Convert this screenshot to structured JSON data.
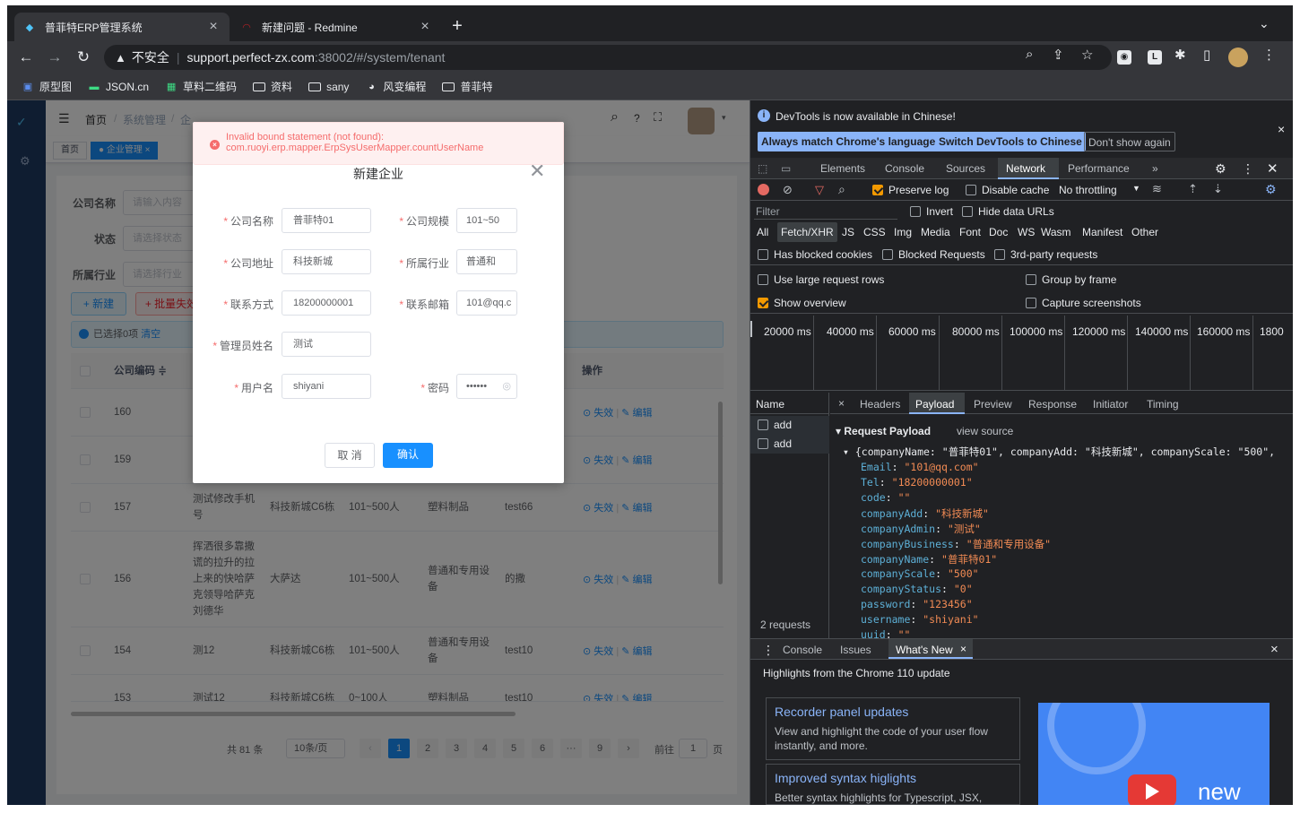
{
  "browser": {
    "tabs": [
      {
        "title": "普菲特ERP管理系统",
        "active": true
      },
      {
        "title": "新建问题 - Redmine",
        "active": false
      }
    ],
    "url": {
      "warning": "不安全",
      "host": "support.perfect-zx.com",
      "path": ":38002/#/system/tenant"
    },
    "bookmarks": [
      "原型图",
      "JSON.cn",
      "草料二维码",
      "资料",
      "sany",
      "风变编程",
      "普菲特"
    ]
  },
  "app": {
    "breadcrumb": [
      "首页",
      "/",
      "系统管理",
      "/",
      "企"
    ],
    "tags": [
      "首页",
      "● 企业管理 ×"
    ],
    "search": {
      "company_label": "公司名称",
      "company_placeholder": "请输入内容",
      "status_label": "状态",
      "status_placeholder": "请选择状态",
      "industry_label": "所属行业",
      "industry_placeholder": "请选择行业"
    },
    "buttons": {
      "add": "+ 新建",
      "batch": "+ 批量失效"
    },
    "selection": {
      "text": "已选择0项",
      "clear": "清空"
    },
    "table": {
      "col_code": "公司编码 ≑",
      "col_ops": "操作",
      "action_disable": "⊙ 失效",
      "action_sep": "|",
      "action_edit": "✎ 编辑",
      "rows": [
        {
          "code": "160",
          "name": "",
          "addr": "",
          "scale": "",
          "industry": "",
          "admin": ""
        },
        {
          "code": "159",
          "name": "",
          "addr": "",
          "scale": "",
          "industry": "",
          "admin": ""
        },
        {
          "code": "157",
          "name": "测试修改手机号",
          "addr": "科技新城C6栋",
          "scale": "101~500人",
          "industry": "塑料制品",
          "admin": "test66"
        },
        {
          "code": "156",
          "name": "挥洒很多靠撒谎的拉升的拉上来的快哈萨克领导哈萨克刘德华",
          "addr": "大萨达",
          "scale": "101~500人",
          "industry": "普通和专用设备",
          "admin": "的撒"
        },
        {
          "code": "154",
          "name": "测12",
          "addr": "科技新城C6栋",
          "scale": "101~500人",
          "industry": "普通和专用设备",
          "admin": "test10"
        },
        {
          "code": "153",
          "name": "测试12",
          "addr": "科技新城C6栋",
          "scale": "0~100人",
          "industry": "塑料制品",
          "admin": "test10"
        }
      ]
    },
    "pagination": {
      "total": "共 81 条",
      "size": "10条/页",
      "pages": [
        "1",
        "2",
        "3",
        "4",
        "5",
        "6",
        "···",
        "9"
      ],
      "current": "1",
      "goto_label": "前往",
      "goto_value": "1",
      "goto_suffix": "页"
    }
  },
  "dialog": {
    "error": {
      "line1": "Invalid bound statement (not found):",
      "line2": "com.ruoyi.erp.mapper.ErpSysUserMapper.countUserName"
    },
    "title": "新建企业",
    "fields": {
      "company_name": {
        "label": "公司名称",
        "value": "普菲特01"
      },
      "company_scale": {
        "label": "公司规模",
        "value": "101~50"
      },
      "company_addr": {
        "label": "公司地址",
        "value": "科技新城"
      },
      "industry": {
        "label": "所属行业",
        "value": "普通和"
      },
      "phone": {
        "label": "联系方式",
        "value": "18200000001"
      },
      "email": {
        "label": "联系邮箱",
        "value": "101@qq.c"
      },
      "admin_name": {
        "label": "管理员姓名",
        "value": "测试"
      },
      "username": {
        "label": "用户名",
        "value": "shiyani"
      },
      "password": {
        "label": "密码",
        "value": "••••••"
      }
    },
    "cancel": "取 消",
    "confirm": "确认"
  },
  "devtools": {
    "banner": "DevTools is now available in Chinese!",
    "banner_buttons": [
      "Always match Chrome's language",
      "Switch DevTools to Chinese",
      "Don't show again"
    ],
    "main_tabs": [
      "Elements",
      "Console",
      "Sources",
      "Network",
      "Performance",
      "»"
    ],
    "active_tab": "Network",
    "toolbar": {
      "preserve_log": "Preserve log",
      "disable_cache": "Disable cache",
      "throttling": "No throttling"
    },
    "filter_placeholder": "Filter",
    "invert": "Invert",
    "hide_data_urls": "Hide data URLs",
    "type_filters": [
      "All",
      "Fetch/XHR",
      "JS",
      "CSS",
      "Img",
      "Media",
      "Font",
      "Doc",
      "WS",
      "Wasm",
      "Manifest",
      "Other"
    ],
    "active_type": "Fetch/XHR",
    "opts": [
      "Has blocked cookies",
      "Blocked Requests",
      "3rd-party requests"
    ],
    "settings": [
      "Use large request rows",
      "Group by frame",
      "Show overview",
      "Capture screenshots"
    ],
    "timeline": [
      "20000 ms",
      "40000 ms",
      "60000 ms",
      "80000 ms",
      "100000 ms",
      "120000 ms",
      "140000 ms",
      "160000 ms",
      "1800"
    ],
    "name_col": "Name",
    "requests": [
      "add",
      "add"
    ],
    "request_count": "2 requests",
    "detail_tabs": [
      "×",
      "Headers",
      "Payload",
      "Preview",
      "Response",
      "Initiator",
      "Timing"
    ],
    "active_detail": "Payload",
    "payload_title": "▾ Request Payload",
    "view_source": "view source",
    "payload_summary": "▾ {companyName: \"普菲特01\", companyAdd: \"科技新城\", companyScale: \"500\",",
    "payload": [
      {
        "k": "Email",
        "v": "\"101@qq.com\""
      },
      {
        "k": "Tel",
        "v": "\"18200000001\""
      },
      {
        "k": "code",
        "v": "\"\""
      },
      {
        "k": "companyAdd",
        "v": "\"科技新城\""
      },
      {
        "k": "companyAdmin",
        "v": "\"测试\""
      },
      {
        "k": "companyBusiness",
        "v": "\"普通和专用设备\""
      },
      {
        "k": "companyName",
        "v": "\"普菲特01\""
      },
      {
        "k": "companyScale",
        "v": "\"500\""
      },
      {
        "k": "companyStatus",
        "v": "\"0\""
      },
      {
        "k": "password",
        "v": "\"123456\""
      },
      {
        "k": "username",
        "v": "\"shiyani\""
      },
      {
        "k": "uuid",
        "v": "\"\""
      }
    ],
    "drawer_tabs": [
      "Console",
      "Issues",
      "What's New"
    ],
    "drawer_close": "×",
    "highlights": "Highlights from the Chrome 110 update",
    "news": [
      {
        "title": "Recorder panel updates",
        "body": "View and highlight the code of your user flow instantly, and more."
      },
      {
        "title": "Improved syntax higlights",
        "body": "Better syntax highlights for Typescript, JSX, SCSS, Vue and more."
      }
    ],
    "promo_text": "new"
  }
}
